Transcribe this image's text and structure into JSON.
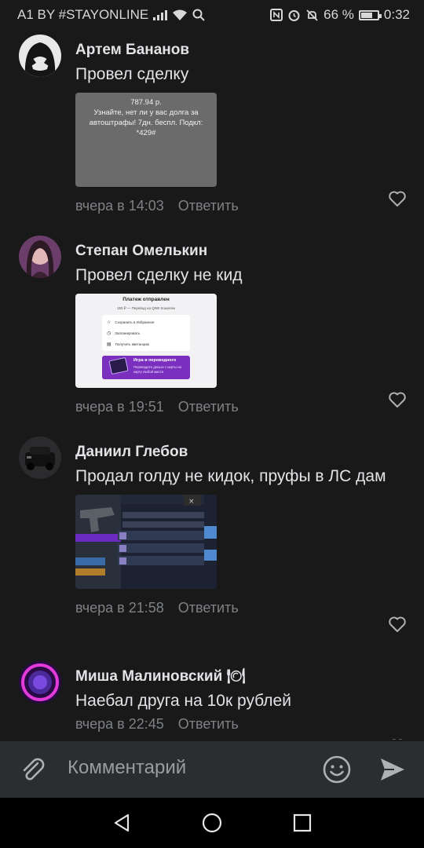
{
  "status_bar": {
    "carrier": "A1 BY #STAYONLINE",
    "battery": "66 %",
    "battery_level": 0.66,
    "time": "0:32"
  },
  "comments": [
    {
      "author": "Артем Бананов",
      "text": "Провел сделку",
      "attachment_text": "787.94 р.\nУзнайте, нет ли у вас долга за автоштрафы! 7дн. беспл. Подкл: *429#",
      "date": "вчера в 14:03",
      "reply": "Ответить"
    },
    {
      "author": "Степан Омелькин",
      "text": "Провел сделку не кид",
      "attachment": {
        "title": "Платеж отправлен",
        "subtitle": "150 ₽ — Перевод на QIWI Кошелек",
        "items": [
          "Сохранить в Избранное",
          "Запланировать",
          "Получить квитанцию"
        ],
        "promo_title": "Игра в переводного",
        "promo_text": "Переводите деньги с карты на карту любой масти"
      },
      "date": "вчера в 19:51",
      "reply": "Ответить"
    },
    {
      "author": "Даниил Глебов",
      "text": "Продал голду не кидок, пруфы в ЛС дам",
      "date": "вчера в 21:58",
      "reply": "Ответить"
    },
    {
      "author": "Миша Малиновский 🍽",
      "text": "Наебал друга на 10к рублей",
      "date": "вчера в 22:45",
      "reply": "Ответить"
    }
  ],
  "composer": {
    "placeholder": "Комментарий"
  },
  "colors": {
    "background": "#19191a",
    "text": "#e1e3e6",
    "secondary": "#7e8185",
    "composer": "#2c2d2e",
    "promo": "#7b2fbe"
  }
}
